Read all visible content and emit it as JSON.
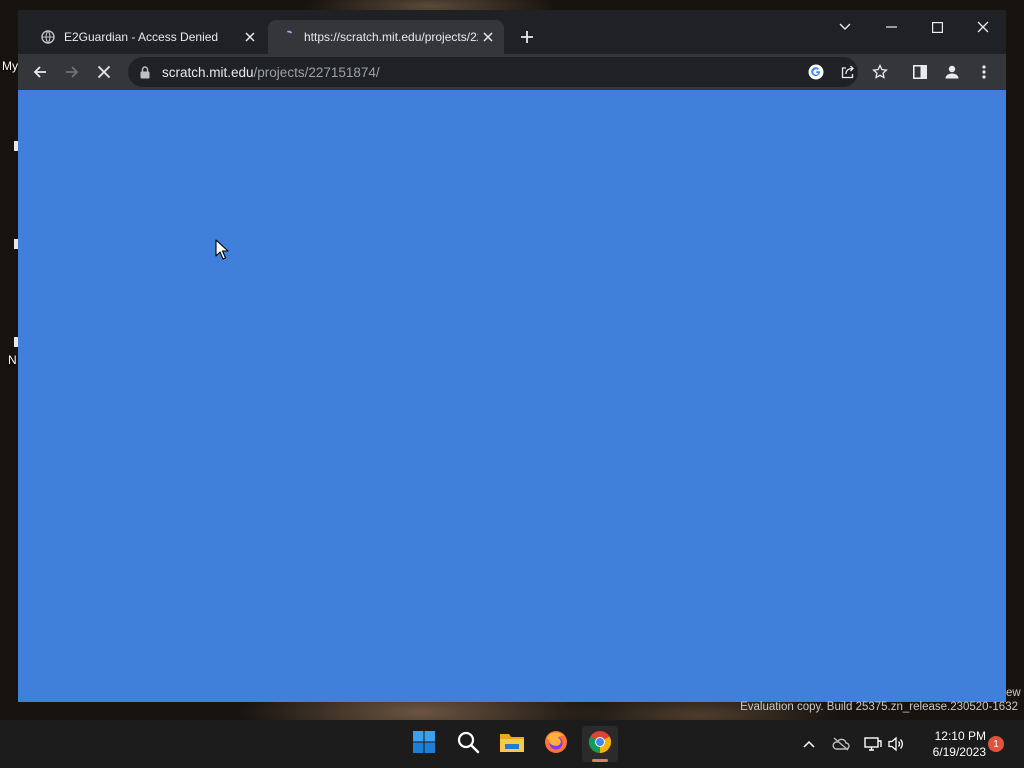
{
  "desktop": {
    "labels": [
      "My",
      "N"
    ],
    "watermark": "Evaluation copy. Build 25375.zn_release.230520-1632",
    "watermark_partial": "ew"
  },
  "browser": {
    "tabs": [
      {
        "title": "E2Guardian - Access Denied",
        "favicon": "globe-icon",
        "active": false
      },
      {
        "title": "https://scratch.mit.edu/projects/227151874/",
        "favicon": "loading-spinner-icon",
        "active": true
      }
    ],
    "address": {
      "host": "scratch.mit.edu",
      "path": "/projects/227151874/"
    },
    "content_color": "#4080da"
  },
  "taskbar": {
    "apps": [
      "start-icon",
      "search-icon",
      "file-explorer-icon",
      "firefox-icon",
      "chrome-icon"
    ],
    "clock": {
      "time": "12:10 PM",
      "date": "6/19/2023"
    },
    "notification_count": "1"
  },
  "colors": {
    "tabstrip": "#202124",
    "toolbar": "#35363a",
    "taskbar": "#1c1c1c",
    "accent_running": "#e27a66"
  }
}
